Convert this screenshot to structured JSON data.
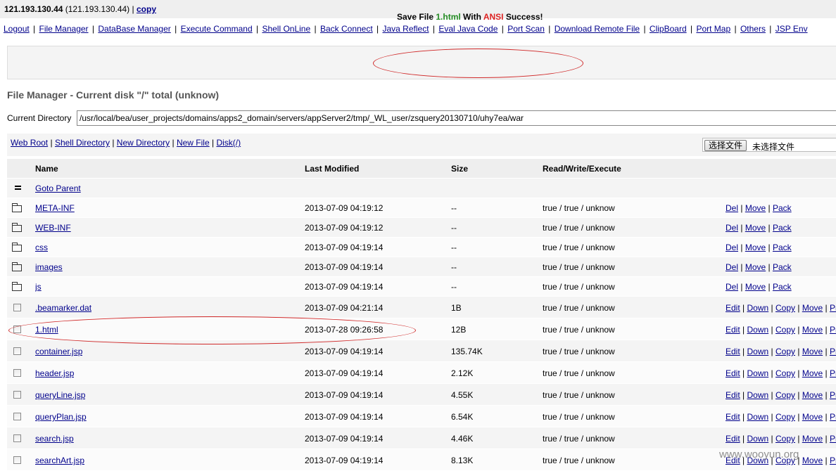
{
  "header": {
    "ip": "121.193.130.44",
    "ip_paren": "(121.193.130.44)",
    "sep": "|",
    "copy_label": "copy"
  },
  "menu": [
    "Logout",
    "File Manager",
    "DataBase Manager",
    "Execute Command",
    "Shell OnLine",
    "Back Connect",
    "Java Reflect",
    "Eval Java Code",
    "Port Scan",
    "Download Remote File",
    "ClipBoard",
    "Port Map",
    "Others",
    "JSP Env"
  ],
  "message": {
    "prefix": "Save File ",
    "filename": "1.html",
    "middle": " With ",
    "encoding": "ANSI",
    "suffix": " Success!",
    "filename_color": "#228b22",
    "encoding_color": "#dd2222"
  },
  "file_manager": {
    "title": "File Manager - Current disk \"/\" total (unknow)",
    "current_dir_label": "Current Directory",
    "current_dir_value": "/usr/local/bea/user_projects/domains/apps2_domain/servers/appServer2/tmp/_WL_user/zsquery20130710/uhy7ea/war"
  },
  "quick_links": [
    "Web Root",
    "Shell Directory",
    "New Directory",
    "New File",
    "Disk(/)"
  ],
  "upload": {
    "button_label": "选择文件",
    "status": "未选择文件"
  },
  "table": {
    "columns": [
      "Name",
      "Last Modified",
      "Size",
      "Read/Write/Execute"
    ],
    "parent_label": "Goto Parent",
    "dir_actions": [
      "Del",
      "Move",
      "Pack"
    ],
    "file_actions": [
      "Edit",
      "Down",
      "Copy",
      "Move",
      "Pr"
    ],
    "directories": [
      {
        "name": "META-INF",
        "modified": "2013-07-09 04:19:12",
        "size": "--",
        "rwx": "true / true / unknow"
      },
      {
        "name": "WEB-INF",
        "modified": "2013-07-09 04:19:12",
        "size": "--",
        "rwx": "true / true / unknow"
      },
      {
        "name": "css",
        "modified": "2013-07-09 04:19:14",
        "size": "--",
        "rwx": "true / true / unknow"
      },
      {
        "name": "images",
        "modified": "2013-07-09 04:19:14",
        "size": "--",
        "rwx": "true / true / unknow"
      },
      {
        "name": "js",
        "modified": "2013-07-09 04:19:14",
        "size": "--",
        "rwx": "true / true / unknow"
      }
    ],
    "files": [
      {
        "name": ".beamarker.dat",
        "modified": "2013-07-09 04:21:14",
        "size": "1B",
        "rwx": "true / true / unknow"
      },
      {
        "name": "1.html",
        "modified": "2013-07-28 09:26:58",
        "size": "12B",
        "rwx": "true / true / unknow"
      },
      {
        "name": "container.jsp",
        "modified": "2013-07-09 04:19:14",
        "size": "135.74K",
        "rwx": "true / true / unknow"
      },
      {
        "name": "header.jsp",
        "modified": "2013-07-09 04:19:14",
        "size": "2.12K",
        "rwx": "true / true / unknow"
      },
      {
        "name": "queryLine.jsp",
        "modified": "2013-07-09 04:19:14",
        "size": "4.55K",
        "rwx": "true / true / unknow"
      },
      {
        "name": "queryPlan.jsp",
        "modified": "2013-07-09 04:19:14",
        "size": "6.54K",
        "rwx": "true / true / unknow"
      },
      {
        "name": "search.jsp",
        "modified": "2013-07-09 04:19:14",
        "size": "4.46K",
        "rwx": "true / true / unknow"
      },
      {
        "name": "searchArt.jsp",
        "modified": "2013-07-09 04:19:14",
        "size": "8.13K",
        "rwx": "true / true / unknow"
      }
    ]
  },
  "watermark": "www.wooyun.org"
}
